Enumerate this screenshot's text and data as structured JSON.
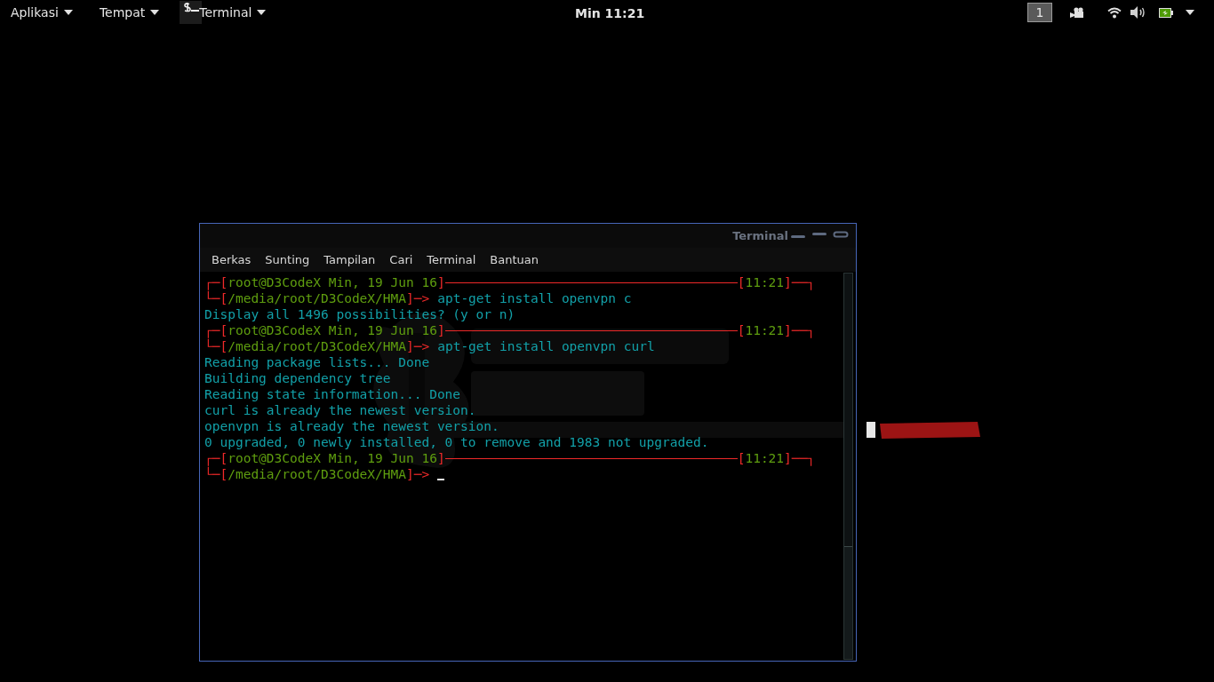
{
  "top_bar": {
    "menus": [
      {
        "label": "Aplikasi"
      },
      {
        "label": "Tempat"
      }
    ],
    "app_menu": {
      "label": "Terminal"
    },
    "clock": "Min 11:21",
    "workspace": "1"
  },
  "terminal": {
    "title": "Terminal",
    "menu": [
      "Berkas",
      "Sunting",
      "Tampilan",
      "Cari",
      "Terminal",
      "Bantuan"
    ],
    "lines": [
      {
        "kind": "prompt_top",
        "segments": [
          {
            "kind": "frame",
            "text": "┌─["
          },
          {
            "kind": "info",
            "text": "root@D3CodeX Min, 19 Jun 16"
          },
          {
            "kind": "frame",
            "text": "]"
          }
        ],
        "right": [
          {
            "kind": "frame",
            "text": "["
          },
          {
            "kind": "info",
            "text": "11:21"
          },
          {
            "kind": "frame",
            "text": "]──┐"
          }
        ]
      },
      {
        "kind": "prompt_bottom",
        "segments": [
          {
            "kind": "frame",
            "text": "└─["
          },
          {
            "kind": "info",
            "text": "/media/root/D3CodeX/HMA"
          },
          {
            "kind": "frame",
            "text": "]─>"
          },
          {
            "kind": "command",
            "text": "apt-get install openvpn c"
          }
        ],
        "cursor": false
      },
      {
        "kind": "output",
        "text": "Display all 1496 possibilities? (y or n)"
      },
      {
        "kind": "prompt_top",
        "segments": [
          {
            "kind": "frame",
            "text": "┌─["
          },
          {
            "kind": "info",
            "text": "root@D3CodeX Min, 19 Jun 16"
          },
          {
            "kind": "frame",
            "text": "]"
          }
        ],
        "right": [
          {
            "kind": "frame",
            "text": "["
          },
          {
            "kind": "info",
            "text": "11:21"
          },
          {
            "kind": "frame",
            "text": "]──┐"
          }
        ]
      },
      {
        "kind": "prompt_bottom",
        "segments": [
          {
            "kind": "frame",
            "text": "└─["
          },
          {
            "kind": "info",
            "text": "/media/root/D3CodeX/HMA"
          },
          {
            "kind": "frame",
            "text": "]─>"
          },
          {
            "kind": "command",
            "text": "apt-get install openvpn curl"
          }
        ],
        "cursor": false
      },
      {
        "kind": "output",
        "text": "Reading package lists... Done"
      },
      {
        "kind": "output",
        "text": "Building dependency tree"
      },
      {
        "kind": "output",
        "text": "Reading state information... Done"
      },
      {
        "kind": "output",
        "text": "curl is already the newest version."
      },
      {
        "kind": "output",
        "text": "openvpn is already the newest version."
      },
      {
        "kind": "output",
        "text": "0 upgraded, 0 newly installed, 0 to remove and 1983 not upgraded."
      },
      {
        "kind": "prompt_top",
        "segments": [
          {
            "kind": "frame",
            "text": "┌─["
          },
          {
            "kind": "info",
            "text": "root@D3CodeX Min, 19 Jun 16"
          },
          {
            "kind": "frame",
            "text": "]"
          }
        ],
        "right": [
          {
            "kind": "frame",
            "text": "["
          },
          {
            "kind": "info",
            "text": "11:21"
          },
          {
            "kind": "frame",
            "text": "]──┐"
          }
        ]
      },
      {
        "kind": "prompt_bottom",
        "segments": [
          {
            "kind": "frame",
            "text": "└─["
          },
          {
            "kind": "info",
            "text": "/media/root/D3CodeX/HMA"
          },
          {
            "kind": "frame",
            "text": "]─>"
          }
        ],
        "cursor": true
      }
    ]
  }
}
